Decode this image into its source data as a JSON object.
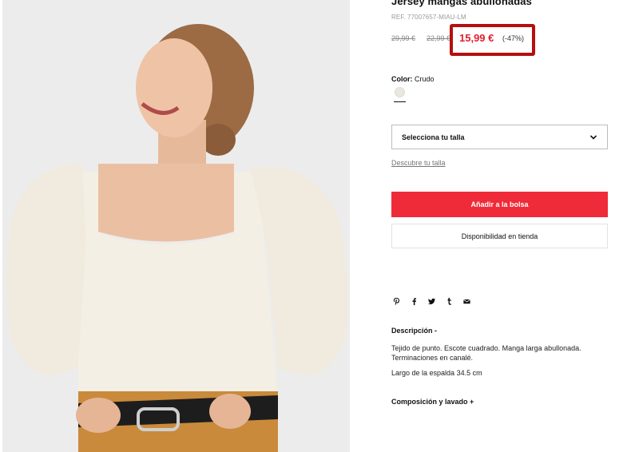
{
  "product": {
    "title": "Jersey mangas abullonadas",
    "ref": "REF. 77007657-MIAU-LM",
    "prices": {
      "original_1": "29,99 €",
      "original_2": "22,99 €",
      "sale": "15,99 €",
      "discount": "(-47%)"
    },
    "color": {
      "label": "Color:",
      "value": "Crudo",
      "swatch_hex": "#ebe7de"
    }
  },
  "size": {
    "select_label": "Selecciona tu talla",
    "guide_link": "Descubre tu talla"
  },
  "actions": {
    "add_to_bag": "Añadir a la bolsa",
    "store_availability": "Disponibilidad en tienda"
  },
  "share": {
    "icons": [
      "pinterest-icon",
      "facebook-icon",
      "twitter-icon",
      "tumblr-icon",
      "email-icon"
    ]
  },
  "description": {
    "title": "Descripción -",
    "text": "Tejido de punto. Escote cuadrado. Manga larga abullonada. Terminaciones en canalé.",
    "back_length": "Largo de la espalda 34.5 cm"
  },
  "composition": {
    "title": "Composición y lavado +"
  },
  "colors": {
    "accent_red": "#ef2b39",
    "price_red": "#e0202f",
    "highlight_border": "#b50f0f"
  }
}
